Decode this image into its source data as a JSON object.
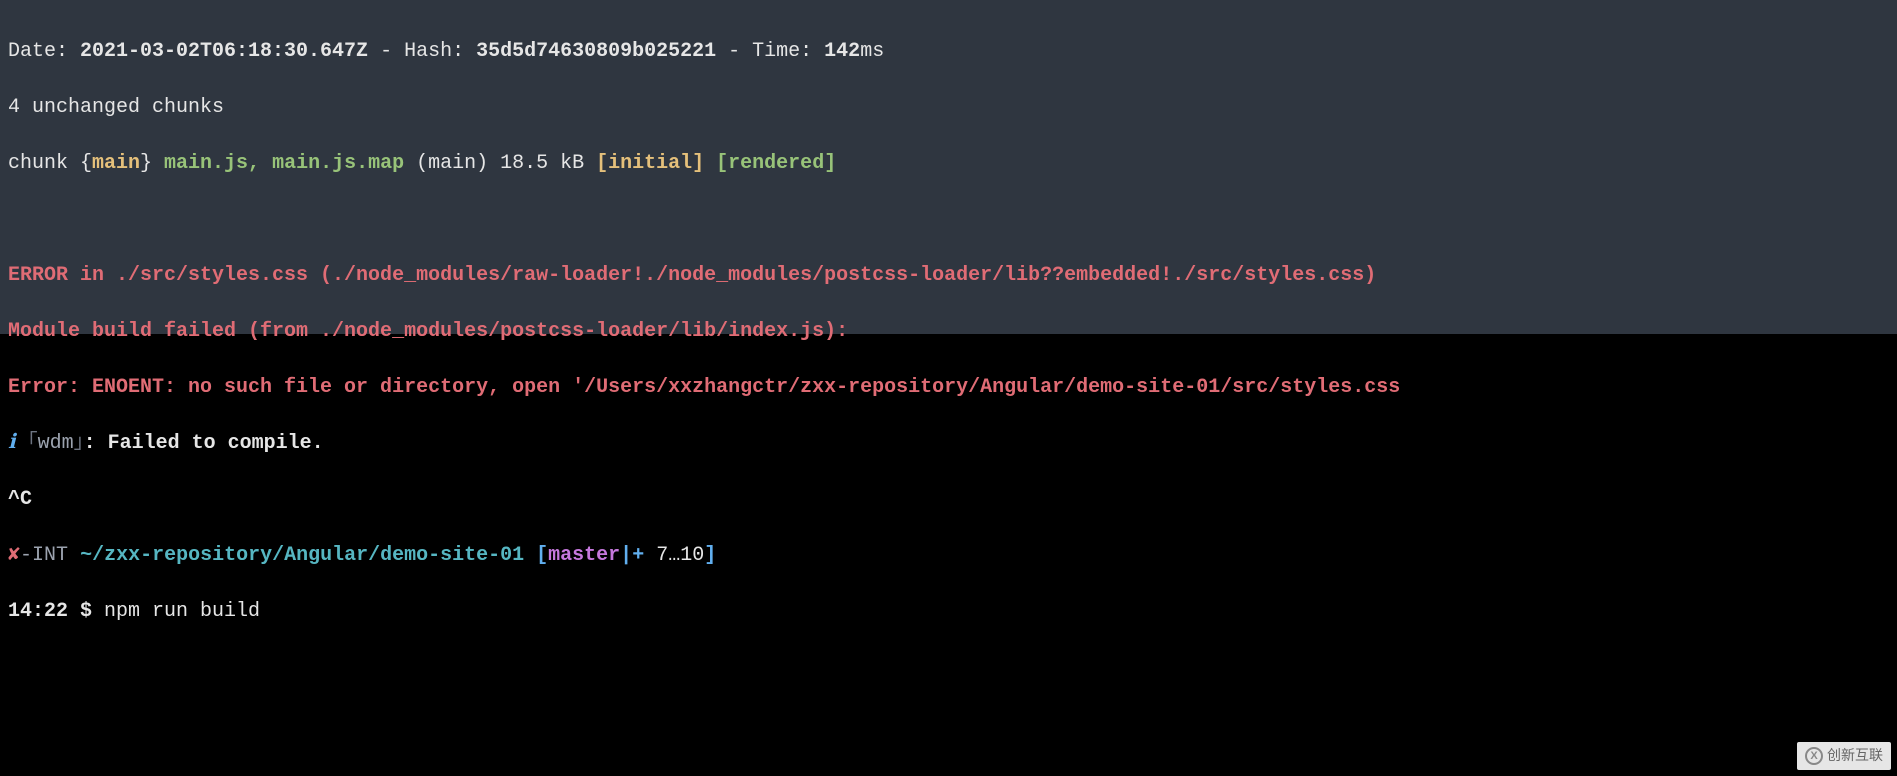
{
  "line1": {
    "date_label": "Date: ",
    "date_value": "2021-03-02T06:18:30.647Z",
    "sep1": " - Hash: ",
    "hash_value": "35d5d74630809b025221",
    "sep2": " - Time: ",
    "time_value": "142",
    "time_unit": "ms"
  },
  "line2": "4 unchanged chunks",
  "line3": {
    "a": "chunk {",
    "b": "main",
    "c": "} ",
    "d": "main.js, main.js.map",
    "e": " (main) 18.5 kB ",
    "f": "[initial]",
    "g": " ",
    "h": "[rendered]"
  },
  "error1": "ERROR in ./src/styles.css (./node_modules/raw-loader!./node_modules/postcss-loader/lib??embedded!./src/styles.css)",
  "error2": "Module build failed (from ./node_modules/postcss-loader/lib/index.js):",
  "error3": "Error: ENOENT: no such file or directory, open '/Users/xxzhangctr/zxx-repository/Angular/demo-site-01/src/styles.css",
  "wdm": {
    "i": "ℹ",
    "l": " ｢",
    "tag": "wdm",
    "r": "｣",
    "msg": ": Failed to compile."
  },
  "ctrlc": "^C",
  "prompt": {
    "x": "✘",
    "int": "-INT",
    "path": " ~/zxx-repository/Angular/demo-site-01 ",
    "lb": "[",
    "branch": "master",
    "pipe": "|",
    "plus": "+",
    "nums": " 7…10",
    "rb": "]"
  },
  "cmd": {
    "time": "14:22 ",
    "dollar": "$ ",
    "text": "npm run build"
  },
  "watermark": "创新互联"
}
